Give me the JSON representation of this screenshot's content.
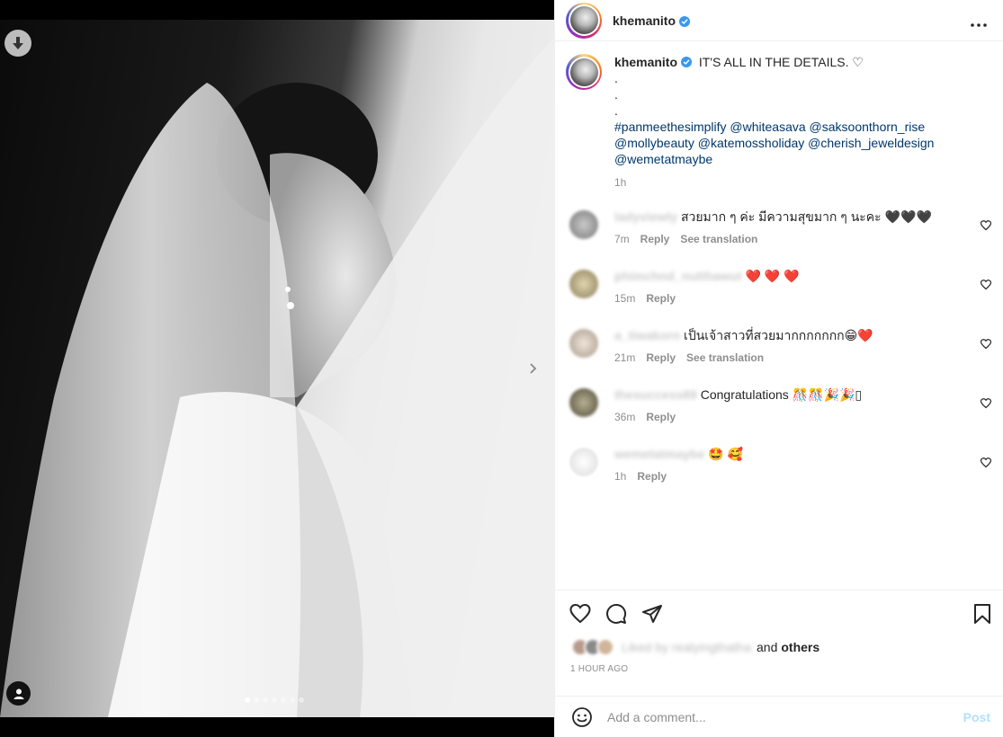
{
  "post": {
    "username": "khemanito",
    "caption_text": "IT'S ALL IN THE DETAILS. ♡",
    "caption_dots": [
      ".",
      ".",
      "."
    ],
    "tags": [
      "#panmeethesimplify @whiteasava @saksoonthorn_rise",
      "@mollybeauty @katemossholiday @cherish_jeweldesign",
      "@wemetatmaybe"
    ],
    "caption_age": "1h"
  },
  "comments": [
    {
      "user": "ladyviewly",
      "text": "สวยมาก ๆ ค่ะ มีความสุขมาก ๆ นะคะ 🖤🖤🖤",
      "age": "7m",
      "reply": "Reply",
      "translate": "See translation"
    },
    {
      "user": "phimchnd_nutthawut",
      "text": "❤️ ❤️ ❤️",
      "age": "15m",
      "reply": "Reply",
      "translate": ""
    },
    {
      "user": "a_tiwakorn",
      "text": "เป็นเจ้าสาวที่สวยมากกกกกกก😁❤️",
      "age": "21m",
      "reply": "Reply",
      "translate": "See translation"
    },
    {
      "user": "thesuccess89",
      "text": "Congratulations 🎊🎊🎉🎉▯",
      "age": "36m",
      "reply": "Reply",
      "translate": ""
    },
    {
      "user": "wemetatmaybe",
      "text": "🤩 🥰",
      "age": "1h",
      "reply": "Reply",
      "translate": ""
    }
  ],
  "likes": {
    "liked_by": "Liked by realyingthatha",
    "and": "and",
    "others": "others",
    "time_ago": "1 HOUR AGO"
  },
  "compose": {
    "placeholder": "Add a comment...",
    "post_label": "Post"
  },
  "icons": {
    "download": "download-icon",
    "tag": "user-tag-icon",
    "next": "chevron-right-icon",
    "more": "more-horizontal-icon",
    "like": "heart-icon",
    "comment": "comment-icon",
    "share": "send-icon",
    "save": "bookmark-icon",
    "emoji": "emoji-icon"
  },
  "carousel": {
    "total": 7,
    "active": 1
  },
  "colors": {
    "link": "#00376b",
    "verified": "#3897f0",
    "post_disabled": "#b2dffc",
    "muted": "#8e8e8e"
  }
}
